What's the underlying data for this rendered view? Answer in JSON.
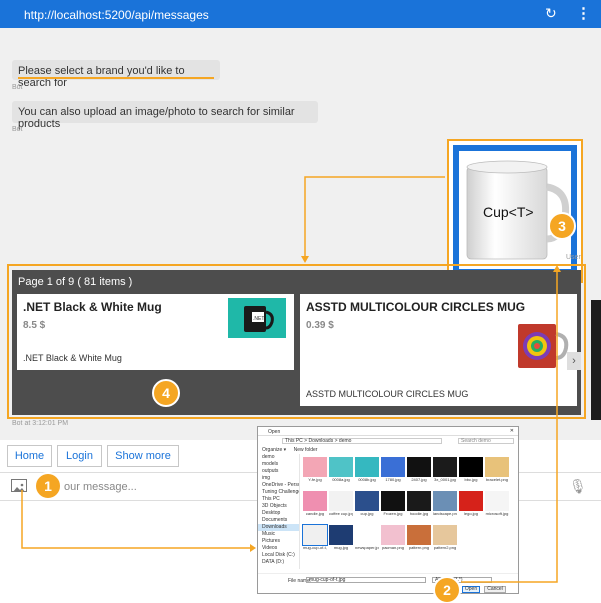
{
  "header": {
    "url": "http://localhost:5200/api/messages",
    "refresh_icon": "refresh-icon",
    "menu_icon": "more-vert-icon"
  },
  "chat": {
    "messages": [
      {
        "text": "Please select a brand you'd like to search for",
        "sender": "Bot"
      },
      {
        "text": "You can also upload an image/photo to search for similar products",
        "sender": "Bot"
      }
    ],
    "user_image": {
      "caption": "Cup<T>",
      "sender": "User"
    },
    "carousel": {
      "paging": "Page 1 of 9 ( 81 items )",
      "cards": [
        {
          "title": ".NET Black & White Mug",
          "price": "8.5 $",
          "description": ".NET Black & White Mug",
          "thumb_text": ".NET"
        },
        {
          "title": "ASSTD MULTICOLOUR CIRCLES MUG",
          "price": "0.39 $",
          "description": "ASSTD MULTICOLOUR CIRCLES MUG"
        }
      ],
      "timestamp": "Bot at 3:12:01 PM"
    }
  },
  "suggested_actions": [
    "Home",
    "Login",
    "Show more"
  ],
  "input": {
    "placeholder": "our message...",
    "upload_icon": "image-upload-icon",
    "mic_icon": "microphone-icon"
  },
  "callouts": [
    "1",
    "2",
    "3",
    "4"
  ],
  "file_dialog": {
    "title": "Open",
    "path": "This PC > Downloads > demo",
    "search_placeholder": "Search demo",
    "toolbar": [
      "Organize ▾",
      "New folder"
    ],
    "tree": [
      "demo",
      "models",
      "outputs",
      "img",
      "OneDrive - Person",
      "Tuning Challenge",
      "This PC",
      "3D Objects",
      "Desktop",
      "Documents",
      "Downloads",
      "Music",
      "Pictures",
      "Videos",
      "Local Disk (C:)",
      "DATA (D:)"
    ],
    "files": [
      {
        "name": "Y-fe.jpg",
        "color": "#f3a6b5"
      },
      {
        "name": "0008a.jpg",
        "color": "#4fc3c7"
      },
      {
        "name": "0008b.jpg",
        "color": "#35b8c0"
      },
      {
        "name": "1780.jpg",
        "color": "#3a6fd6"
      },
      {
        "name": "2407.jpg",
        "color": "#111111"
      },
      {
        "name": "3x_0001.jpg",
        "color": "#1b1b1b"
      },
      {
        "name": "bbc.jpg",
        "color": "#000000"
      },
      {
        "name": "bracelet.png",
        "color": "#e8c27a"
      },
      {
        "name": "candle.jpg",
        "color": "#ef8fb0"
      },
      {
        "name": "coffee cup.jpg",
        "color": "#f2f2f2"
      },
      {
        "name": "cup.jpg",
        "color": "#2b4f8c"
      },
      {
        "name": "Frozen.jpg",
        "color": "#111111"
      },
      {
        "name": "hoodie.jpg",
        "color": "#1a1a1a"
      },
      {
        "name": "landscape.png",
        "color": "#6b8fb5"
      },
      {
        "name": "lego.jpg",
        "color": "#d6221a"
      },
      {
        "name": "microsoft.jpg",
        "color": "#f5f5f5"
      },
      {
        "name": "mug-cup-of-t.jpg",
        "color": "#f0f0f0"
      },
      {
        "name": "mug.jpg",
        "color": "#1e3c72"
      },
      {
        "name": "newspaper.jpg",
        "color": "#ffffff"
      },
      {
        "name": "pacman.png",
        "color": "#f2c0cf"
      },
      {
        "name": "pattern.png",
        "color": "#c96f3a"
      },
      {
        "name": "pattern2.png",
        "color": "#e6c79c"
      }
    ],
    "file_name_label": "File name:",
    "file_name": "mug-cup-of-t.jpg",
    "file_type": "All Files (*.*)",
    "open_button": "Open",
    "cancel_button": "Cancel"
  },
  "colors": {
    "accent": "#1a73d9",
    "callout": "#f5a623",
    "carousel_bg": "#4d4d4d"
  }
}
